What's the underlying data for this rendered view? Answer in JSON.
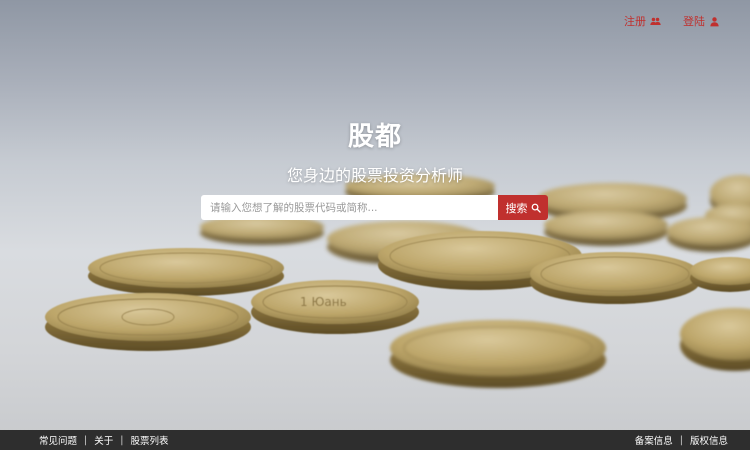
{
  "nav": {
    "register_label": "注册",
    "login_label": "登陆",
    "accent_color": "#c0302e"
  },
  "hero": {
    "title": "股都",
    "subtitle": "您身边的股票投资分析师"
  },
  "search": {
    "placeholder": "请输入您想了解的股票代码或简称...",
    "value": "",
    "button_label": "搜索",
    "button_icon": "search-icon"
  },
  "footer": {
    "left_links": [
      "常见问题",
      "关于",
      "股票列表"
    ],
    "right_links": [
      "备案信息",
      "版权信息"
    ],
    "separator": "|"
  },
  "icons": {
    "register": "users-icon",
    "login": "user-icon"
  }
}
